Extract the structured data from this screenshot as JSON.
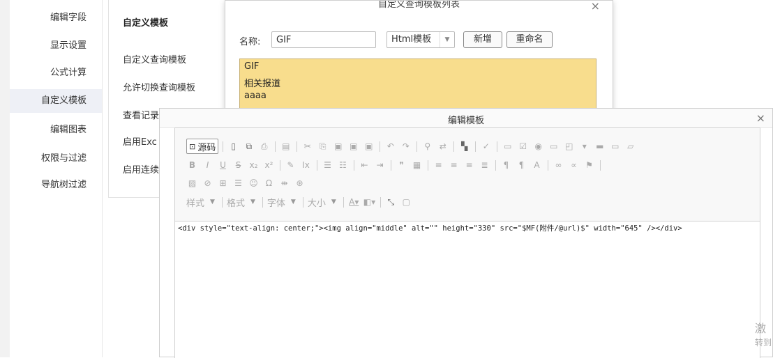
{
  "left_nav": [
    {
      "label": "编辑字段",
      "active": false
    },
    {
      "label": "显示设置",
      "active": false
    },
    {
      "label": "公式计算",
      "active": false
    },
    {
      "label": "自定义模板",
      "active": true
    },
    {
      "label": "编辑图表",
      "active": false
    },
    {
      "label": "权限与过滤",
      "active": false
    },
    {
      "label": "导航树过滤",
      "active": false
    }
  ],
  "sub_nav": {
    "header": "自定义模板",
    "items": [
      "自定义查询模板",
      "允许切换查询模板",
      "查看记录",
      "启用Exc",
      "启用连续"
    ]
  },
  "list_dialog": {
    "title": "自定义查询模板列表",
    "close": "×",
    "name_label": "名称:",
    "name_value": "GIF",
    "type_select": "Html模板",
    "add_button": "新增",
    "rename_button": "重命名",
    "templates": [
      "GIF",
      "相关报道",
      "aaaa"
    ]
  },
  "edit_dialog": {
    "title": "编辑模板",
    "close": "×",
    "source_button": "源码",
    "combos": [
      "样式",
      "格式",
      "字体",
      "大小"
    ],
    "code": "<div style=\"text-align: center;\"><img align=\"middle\" alt=\"\" height=\"330\" src=\"$MF(附件/@url)$\" width=\"645\" /></div>"
  },
  "peek_text": {
    "line1": "激",
    "line2": "转到"
  }
}
